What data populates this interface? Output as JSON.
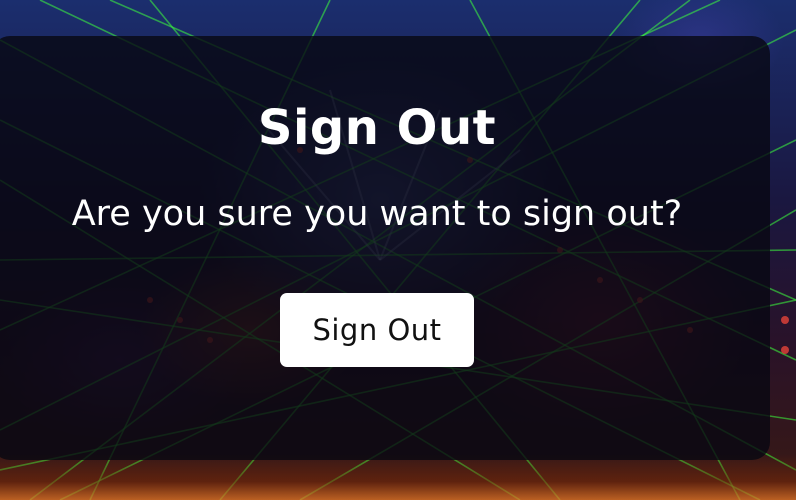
{
  "dialog": {
    "title": "Sign Out",
    "message": "Are you sure you want to sign out?",
    "confirm_label": "Sign Out"
  },
  "colors": {
    "overlay": "#08080F",
    "text": "#FFFFFF",
    "button_bg": "#FFFFFF",
    "button_text": "#111111",
    "laser": "#3CFF3C"
  }
}
